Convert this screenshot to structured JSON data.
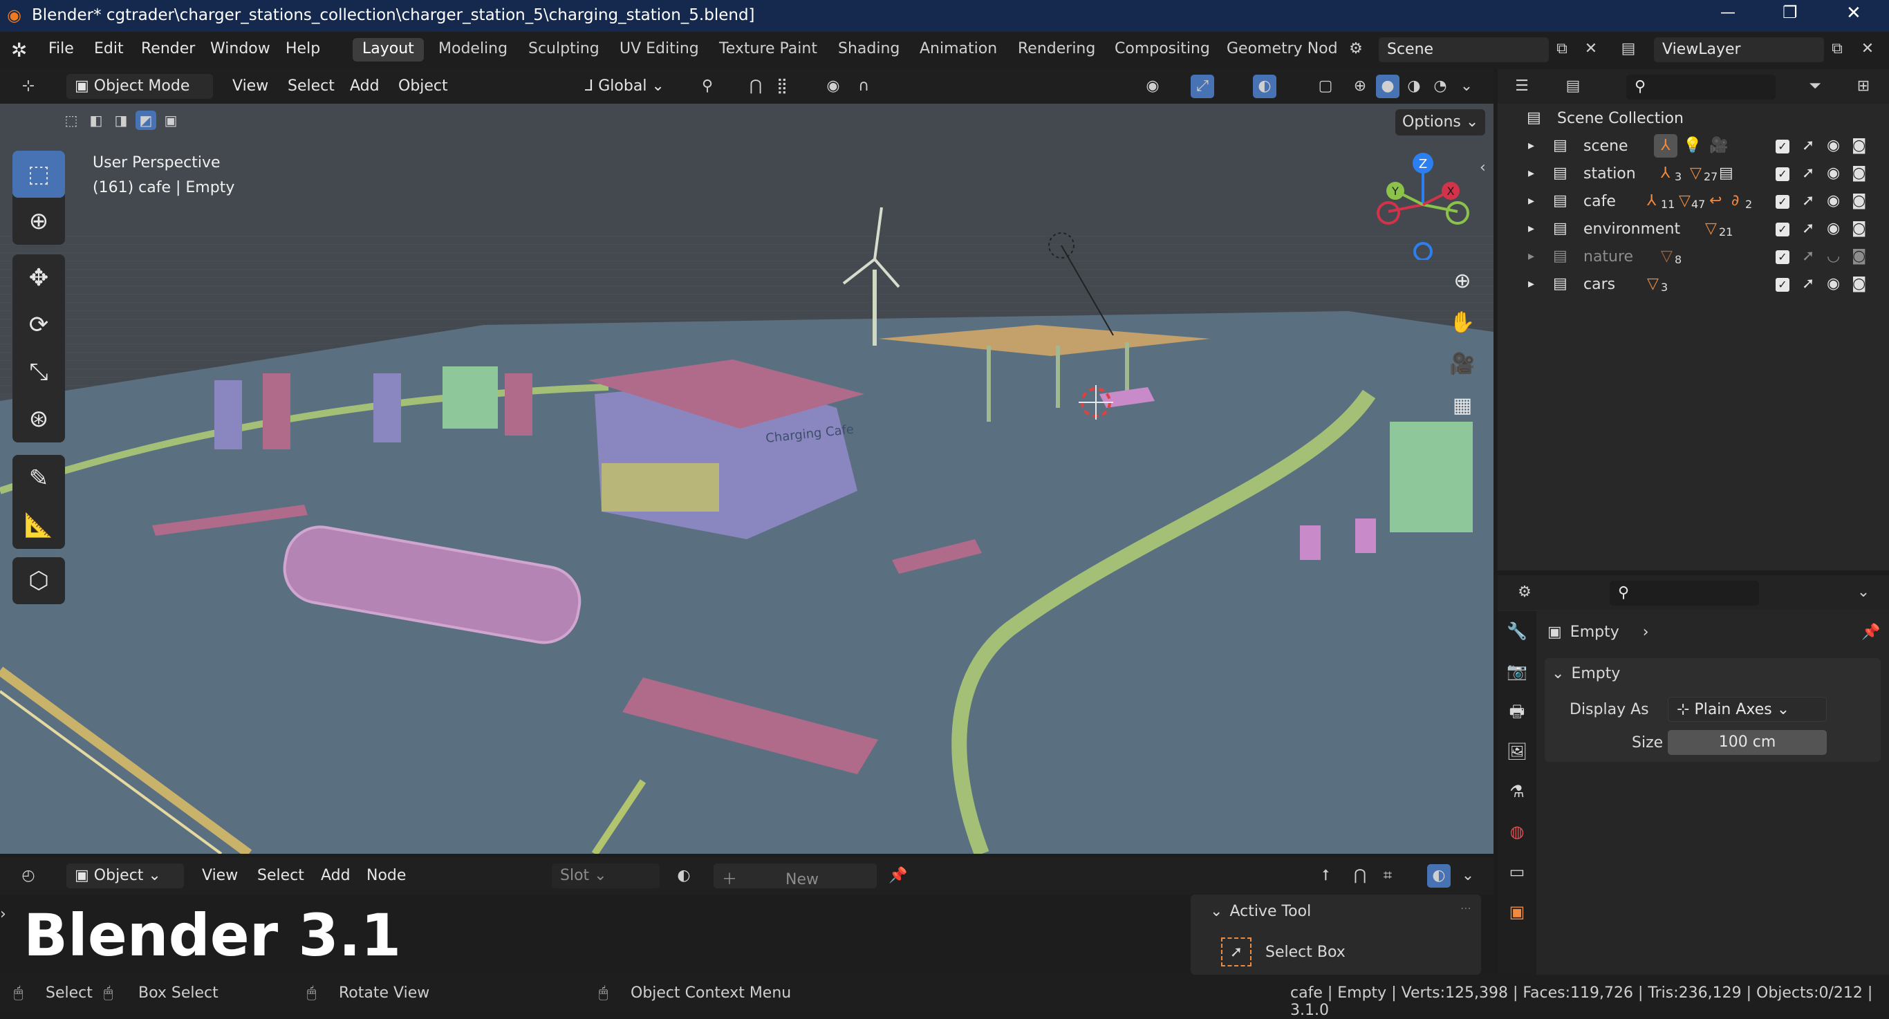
{
  "titlebar": {
    "title": "Blender* cgtrader\\charger_stations_collection\\charger_station_5\\charging_station_5.blend]",
    "minimize": "—",
    "maximize": "❐",
    "close": "✕"
  },
  "menubar": {
    "menus": [
      "File",
      "Edit",
      "Render",
      "Window",
      "Help"
    ],
    "workspaces": [
      "Layout",
      "Modeling",
      "Sculpting",
      "UV Editing",
      "Texture Paint",
      "Shading",
      "Animation",
      "Rendering",
      "Compositing",
      "Geometry Nod"
    ],
    "active_workspace": "Layout",
    "scene": "Scene",
    "view_layer": "ViewLayer"
  },
  "viewport_header": {
    "mode": "Object Mode",
    "menus": [
      "View",
      "Select",
      "Add",
      "Object"
    ],
    "orientation": "Global",
    "options": "Options"
  },
  "viewport": {
    "perspective": "User Perspective",
    "context": "(161) cafe | Empty",
    "storefront_sign": "Charging Cafe"
  },
  "gizmo": {
    "z": "Z",
    "y": "Y",
    "x": "X"
  },
  "outliner": {
    "root": "Scene Collection",
    "collections": [
      {
        "name": "scene",
        "badges": []
      },
      {
        "name": "station",
        "badges": [
          "3",
          "27"
        ]
      },
      {
        "name": "cafe",
        "badges": [
          "11",
          "47",
          "2"
        ]
      },
      {
        "name": "environment",
        "badges": [
          "21"
        ]
      },
      {
        "name": "nature",
        "badges": [
          "8"
        ]
      },
      {
        "name": "cars",
        "badges": [
          "3"
        ]
      }
    ]
  },
  "properties": {
    "object": "Empty",
    "panel": "Empty",
    "display_as_label": "Display As",
    "display_as_value": "Plain Axes",
    "size_label": "Size",
    "size_value": "100 cm"
  },
  "editor_header": {
    "type": "Object",
    "menus": [
      "View",
      "Select",
      "Add",
      "Node"
    ],
    "slot": "Slot",
    "new": "New"
  },
  "overlay_text": "Blender 3.1",
  "active_tool": {
    "header": "Active Tool",
    "tool": "Select Box"
  },
  "statusbar": {
    "select": "Select",
    "box_select": "Box Select",
    "rotate_view": "Rotate View",
    "context_menu": "Object Context Menu",
    "stats": "cafe | Empty | Verts:125,398 | Faces:119,726 | Tris:236,129 | Objects:0/212 | 3.1.0"
  },
  "colors": {
    "accent": "#4772b3",
    "titlebar": "#14294d",
    "viewport_bg": "#444b52",
    "ground": "#5a7080",
    "road_curb": "#a4c077",
    "parking_marks": "#b06a8a"
  }
}
